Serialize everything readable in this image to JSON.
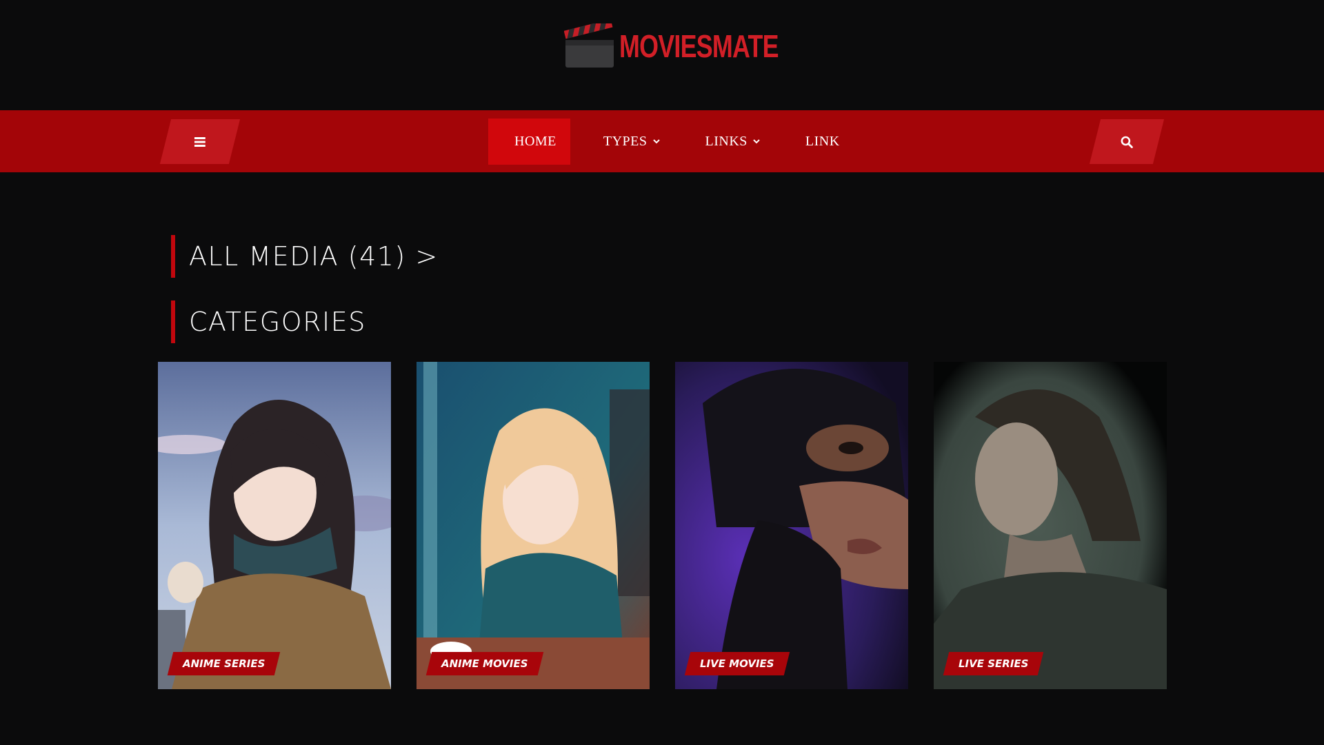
{
  "brand": {
    "name": "MOVIESMATE",
    "logo_icon": "clapperboard-icon",
    "accent": "#d21f27"
  },
  "nav": {
    "menu_icon": "hamburger-icon",
    "search_icon": "search-icon",
    "bar_color": "#a30508",
    "items": [
      {
        "label": "HOME",
        "active": true
      },
      {
        "label": "TYPES",
        "dropdown": true
      },
      {
        "label": "LINKS",
        "dropdown": true
      },
      {
        "label": "LINK"
      }
    ]
  },
  "sections": {
    "all_media": "ALL MEDIA (41) >",
    "categories": "CATEGORIES"
  },
  "categories": [
    {
      "label": "ANIME SERIES"
    },
    {
      "label": "ANIME MOVIES"
    },
    {
      "label": "LIVE MOVIES"
    },
    {
      "label": "LIVE SERIES"
    }
  ]
}
